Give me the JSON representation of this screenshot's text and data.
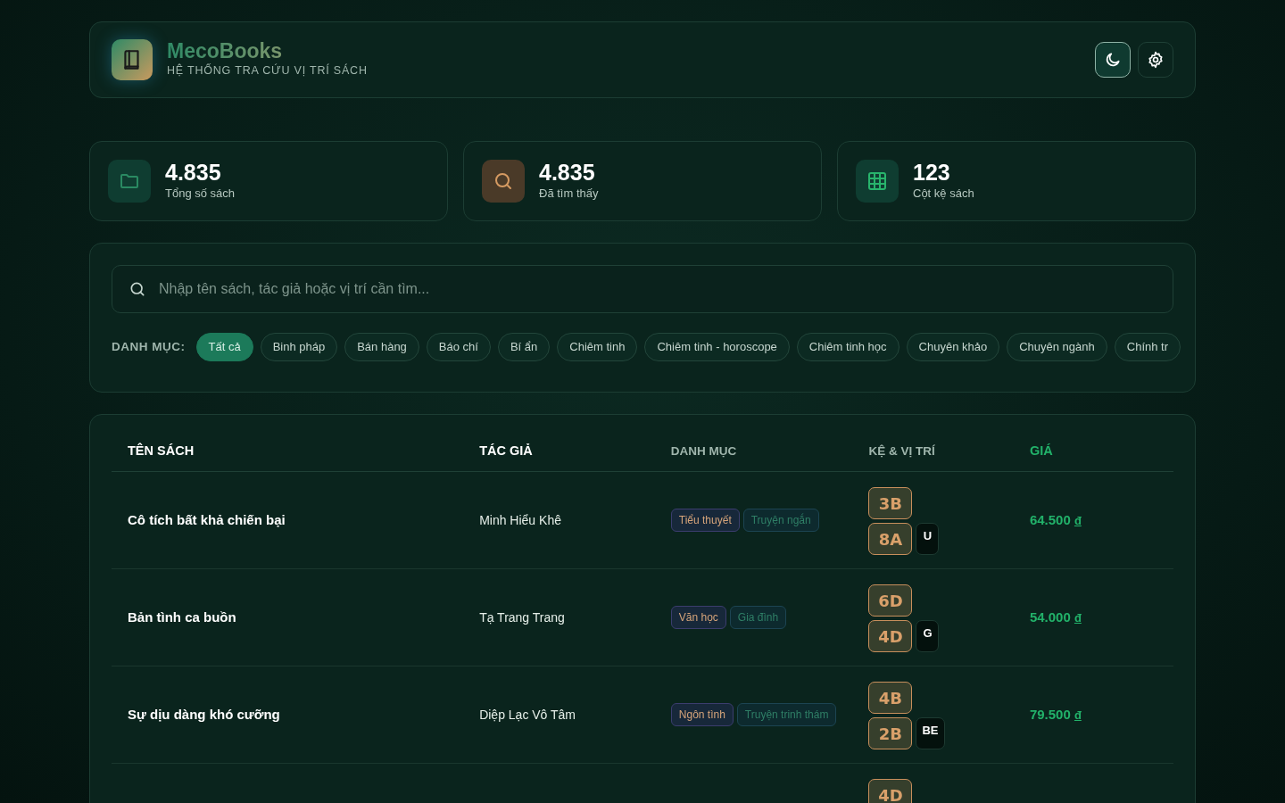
{
  "brand": {
    "name": "MecoBooks",
    "subtitle": "HỆ THỐNG TRA CỨU VỊ TRÍ SÁCH"
  },
  "header_buttons": [
    {
      "kind": "theme",
      "selected": true
    },
    {
      "kind": "settings",
      "selected": false
    }
  ],
  "stats": [
    {
      "kind": "folder",
      "value": "4.835",
      "label": "Tổng số sách"
    },
    {
      "kind": "search",
      "value": "4.835",
      "label": "Đã tìm thấy"
    },
    {
      "kind": "grid",
      "value": "123",
      "label": "Cột kệ sách"
    }
  ],
  "search": {
    "placeholder": "Nhập tên sách, tác giả hoặc vị trí cần tìm..."
  },
  "categories": {
    "label": "DANH MỤC:",
    "items": [
      {
        "label": "Tất cả",
        "selected": true
      },
      {
        "label": "Binh pháp",
        "selected": false
      },
      {
        "label": "Bán hàng",
        "selected": false
      },
      {
        "label": "Báo chí",
        "selected": false
      },
      {
        "label": "Bí ẩn",
        "selected": false
      },
      {
        "label": "Chiêm tinh",
        "selected": false
      },
      {
        "label": "Chiêm tinh - horoscope",
        "selected": false
      },
      {
        "label": "Chiêm tinh học",
        "selected": false
      },
      {
        "label": "Chuyên khảo",
        "selected": false
      },
      {
        "label": "Chuyên ngành",
        "selected": false
      },
      {
        "label": "Chính tr",
        "selected": false
      }
    ]
  },
  "table": {
    "columns": [
      "TÊN SÁCH",
      "TÁC GIẢ",
      "DANH MỤC",
      "KỆ & VỊ TRÍ",
      "GIÁ"
    ],
    "rows": [
      {
        "title": "Cô tích bất khả chiến bại",
        "author": "Minh Hiểu Khê",
        "tags": [
          {
            "label": "Tiểu thuyết",
            "kind": "primary"
          },
          {
            "label": "Truyện ngắn",
            "kind": "secondary"
          }
        ],
        "shelves": [
          "3B",
          "8A"
        ],
        "position": "U",
        "price": "64.500",
        "currency": "đ"
      },
      {
        "title": "Bản tình ca buồn",
        "author": "Tạ Trang Trang",
        "tags": [
          {
            "label": "Văn học",
            "kind": "primary"
          },
          {
            "label": "Gia đình",
            "kind": "secondary"
          }
        ],
        "shelves": [
          "6D",
          "4D"
        ],
        "position": "G",
        "price": "54.000",
        "currency": "đ"
      },
      {
        "title": "Sự dịu dàng khó cưỡng",
        "author": "Diệp Lạc Vô Tâm",
        "tags": [
          {
            "label": "Ngôn tình",
            "kind": "primary"
          },
          {
            "label": "Truyện trinh thám",
            "kind": "secondary"
          }
        ],
        "shelves": [
          "4B",
          "2B"
        ],
        "position": "BE",
        "price": "79.500",
        "currency": "đ"
      },
      {
        "shelves": [
          "4D"
        ]
      }
    ]
  }
}
